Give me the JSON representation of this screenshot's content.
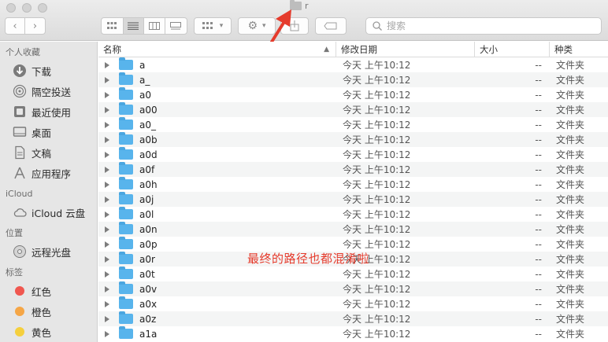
{
  "window": {
    "title": "r"
  },
  "toolbar": {
    "back_icon": "chevron-left",
    "forward_icon": "chevron-right",
    "search_placeholder": "搜索"
  },
  "sidebar": {
    "sections": [
      {
        "header": "个人收藏",
        "items": [
          {
            "label": "下载",
            "icon": "download-icon"
          },
          {
            "label": "隔空投送",
            "icon": "airdrop-icon"
          },
          {
            "label": "最近使用",
            "icon": "recents-icon"
          },
          {
            "label": "桌面",
            "icon": "desktop-icon"
          },
          {
            "label": "文稿",
            "icon": "documents-icon"
          },
          {
            "label": "应用程序",
            "icon": "applications-icon"
          }
        ]
      },
      {
        "header": "iCloud",
        "items": [
          {
            "label": "iCloud 云盘",
            "icon": "cloud-icon"
          }
        ]
      },
      {
        "header": "位置",
        "items": [
          {
            "label": "远程光盘",
            "icon": "disc-icon"
          }
        ]
      },
      {
        "header": "标签",
        "items": [
          {
            "label": "红色",
            "color": "#f0574f"
          },
          {
            "label": "橙色",
            "color": "#f5a646"
          },
          {
            "label": "黄色",
            "color": "#f5cf3d"
          }
        ]
      }
    ]
  },
  "columns": {
    "name": "名称",
    "date": "修改日期",
    "size": "大小",
    "kind": "种类"
  },
  "files": [
    {
      "name": "a",
      "date": "今天 上午10:12",
      "size": "--",
      "kind": "文件夹"
    },
    {
      "name": "a_",
      "date": "今天 上午10:12",
      "size": "--",
      "kind": "文件夹"
    },
    {
      "name": "a0",
      "date": "今天 上午10:12",
      "size": "--",
      "kind": "文件夹"
    },
    {
      "name": "a00",
      "date": "今天 上午10:12",
      "size": "--",
      "kind": "文件夹"
    },
    {
      "name": "a0_",
      "date": "今天 上午10:12",
      "size": "--",
      "kind": "文件夹"
    },
    {
      "name": "a0b",
      "date": "今天 上午10:12",
      "size": "--",
      "kind": "文件夹"
    },
    {
      "name": "a0d",
      "date": "今天 上午10:12",
      "size": "--",
      "kind": "文件夹"
    },
    {
      "name": "a0f",
      "date": "今天 上午10:12",
      "size": "--",
      "kind": "文件夹"
    },
    {
      "name": "a0h",
      "date": "今天 上午10:12",
      "size": "--",
      "kind": "文件夹"
    },
    {
      "name": "a0j",
      "date": "今天 上午10:12",
      "size": "--",
      "kind": "文件夹"
    },
    {
      "name": "a0l",
      "date": "今天 上午10:12",
      "size": "--",
      "kind": "文件夹"
    },
    {
      "name": "a0n",
      "date": "今天 上午10:12",
      "size": "--",
      "kind": "文件夹"
    },
    {
      "name": "a0p",
      "date": "今天 上午10:12",
      "size": "--",
      "kind": "文件夹"
    },
    {
      "name": "a0r",
      "date": "今天 上午10:12",
      "size": "--",
      "kind": "文件夹"
    },
    {
      "name": "a0t",
      "date": "今天 上午10:12",
      "size": "--",
      "kind": "文件夹"
    },
    {
      "name": "a0v",
      "date": "今天 上午10:12",
      "size": "--",
      "kind": "文件夹"
    },
    {
      "name": "a0x",
      "date": "今天 上午10:12",
      "size": "--",
      "kind": "文件夹"
    },
    {
      "name": "a0z",
      "date": "今天 上午10:12",
      "size": "--",
      "kind": "文件夹"
    },
    {
      "name": "a1a",
      "date": "今天 上午10:12",
      "size": "--",
      "kind": "文件夹"
    }
  ],
  "annotation": {
    "text": "最终的路径也都混淆啦",
    "color": "#e53b2c"
  }
}
